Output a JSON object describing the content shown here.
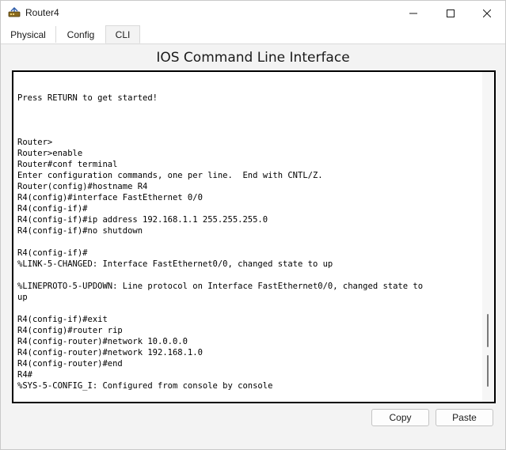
{
  "window": {
    "title": "Router4",
    "icon": "router-icon",
    "controls": [
      "minimize-icon",
      "maximize-icon",
      "close-icon"
    ]
  },
  "tabs": [
    {
      "label": "Physical",
      "active": false
    },
    {
      "label": "Config",
      "active": false
    },
    {
      "label": "CLI",
      "active": true
    }
  ],
  "header": {
    "title": "IOS Command Line Interface"
  },
  "console": {
    "text": "Press RETURN to get started!\n\n\n\nRouter>\nRouter>enable\nRouter#conf terminal\nEnter configuration commands, one per line.  End with CNTL/Z.\nRouter(config)#hostname R4\nR4(config)#interface FastEthernet 0/0\nR4(config-if)#\nR4(config-if)#ip address 192.168.1.1 255.255.255.0\nR4(config-if)#no shutdown\n\nR4(config-if)#\n%LINK-5-CHANGED: Interface FastEthernet0/0, changed state to up\n\n%LINEPROTO-5-UPDOWN: Line protocol on Interface FastEthernet0/0, changed state to\nup\n\nR4(config-if)#exit\nR4(config)#router rip\nR4(config-router)#network 10.0.0.0\nR4(config-router)#network 192.168.1.0\nR4(config-router)#end\nR4#\n%SYS-5-CONFIG_I: Configured from console by console"
  },
  "buttons": {
    "copy": "Copy",
    "paste": "Paste"
  }
}
